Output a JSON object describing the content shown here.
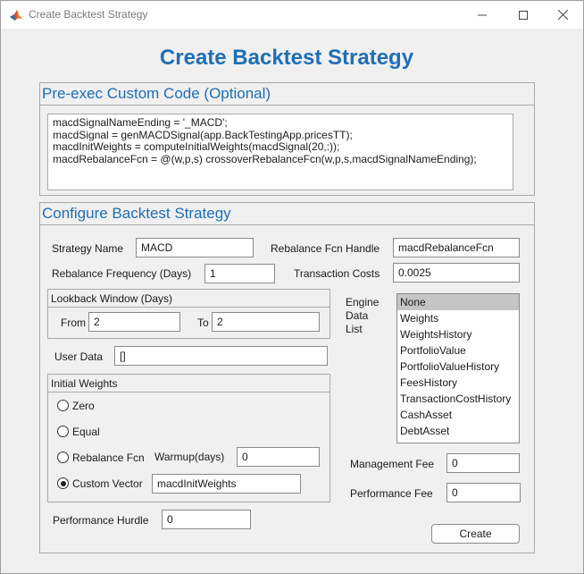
{
  "window": {
    "title": "Create Backtest Strategy"
  },
  "heading": "Create Backtest Strategy",
  "preexec": {
    "title": "Pre-exec Custom Code (Optional)",
    "code": "macdSignalNameEnding = '_MACD';\nmacdSignal = genMACDSignal(app.BackTestingApp.pricesTT);\nmacdInitWeights = computeInitialWeights(macdSignal(20,:));\nmacdRebalanceFcn = @(w,p,s) crossoverRebalanceFcn(w,p,s,macdSignalNameEnding);"
  },
  "configure": {
    "title": "Configure Backtest Strategy",
    "strategy_name_label": "Strategy Name",
    "strategy_name_value": "MACD",
    "rebalance_handle_label": "Rebalance Fcn Handle",
    "rebalance_handle_value": "macdRebalanceFcn",
    "rebalance_freq_label": "Rebalance Frequency (Days)",
    "rebalance_freq_value": "1",
    "transaction_costs_label": "Transaction Costs",
    "transaction_costs_value": "0.0025",
    "lookback": {
      "title": "Lookback Window (Days)",
      "from_label": "From",
      "from_value": "2",
      "to_label": "To",
      "to_value": "2"
    },
    "user_data_label": "User Data",
    "user_data_value": "[]",
    "initial_weights": {
      "title": "Initial Weights",
      "options": [
        "Zero",
        "Equal",
        "Rebalance Fcn",
        "Custom Vector"
      ],
      "selected": "Custom Vector",
      "warmup_label": "Warmup(days)",
      "warmup_value": "0",
      "custom_vector_value": "macdInitWeights"
    },
    "engine_data": {
      "label_line1": "Engine",
      "label_line2": "Data",
      "label_line3": "List",
      "items": [
        "None",
        "Weights",
        "WeightsHistory",
        "PortfolioValue",
        "PortfolioValueHistory",
        "FeesHistory",
        "TransactionCostHistory",
        "CashAsset",
        "DebtAsset"
      ],
      "selected": "None"
    },
    "management_fee_label": "Management Fee",
    "management_fee_value": "0",
    "performance_fee_label": "Performance Fee",
    "performance_fee_value": "0",
    "performance_hurdle_label": "Performance Hurdle",
    "performance_hurdle_value": "0",
    "create_label": "Create"
  }
}
